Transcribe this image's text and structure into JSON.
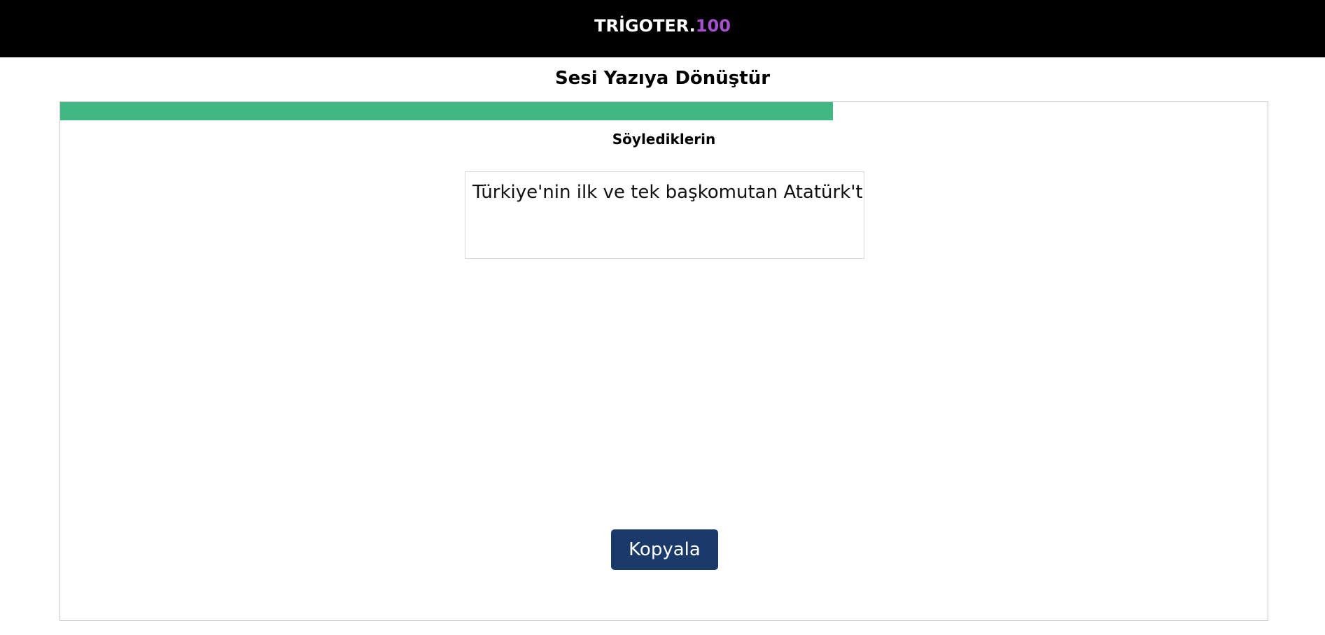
{
  "header": {
    "brand_main": "TRİGOTER.",
    "brand_accent": "100",
    "accent_color": "#a84fd0",
    "background_color": "#000000"
  },
  "page": {
    "title": "Sesi Yazıya Dönüştür"
  },
  "panel": {
    "progress": {
      "value_percent": 64,
      "color": "#41b883"
    },
    "section_label": "Söylediklerin",
    "transcript_text": "Türkiye'nin ilk ve tek başkomutan Atatürk'tür",
    "copy_button_label": "Kopyala",
    "copy_button_color": "#1a3a6b"
  }
}
